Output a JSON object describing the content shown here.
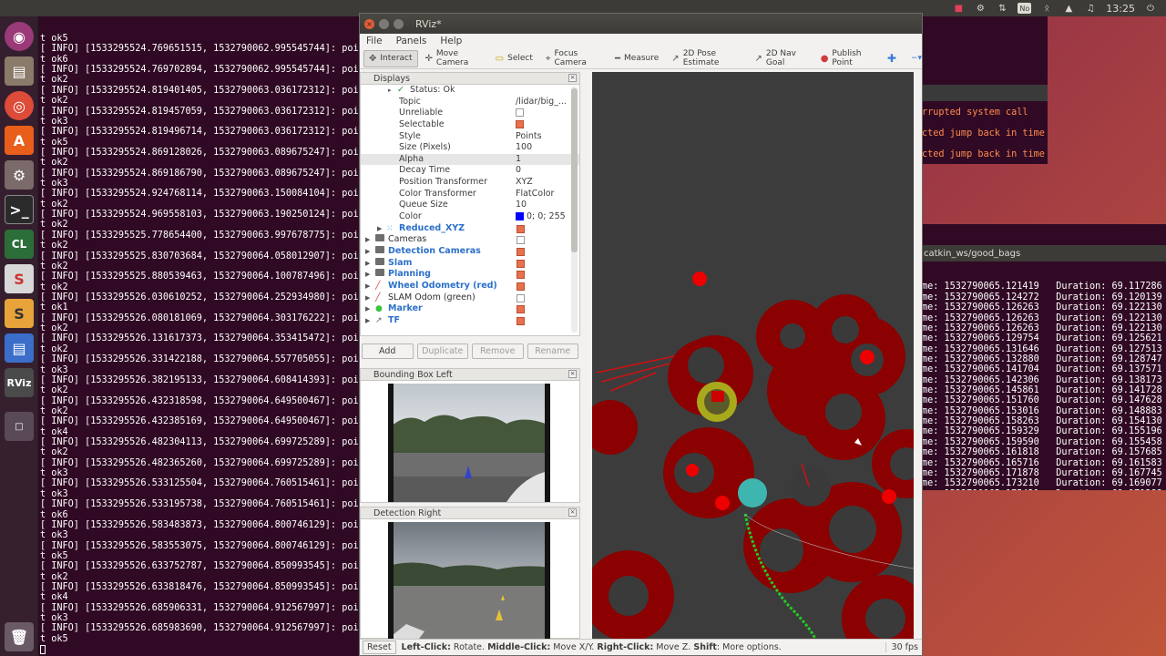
{
  "topbar": {
    "time": "13:25",
    "no_badge": "No"
  },
  "term_left_lines": [
    "t ok5",
    "[ INFO] [1533295524.769651515, 1532790062.995545744]: poin",
    "t ok6",
    "[ INFO] [1533295524.769702894, 1532790062.995545744]: poin",
    "t ok2",
    "[ INFO] [1533295524.819401405, 1532790063.036172312]: poin",
    "t ok2",
    "[ INFO] [1533295524.819457059, 1532790063.036172312]: poin",
    "t ok3",
    "[ INFO] [1533295524.819496714, 1532790063.036172312]: poin",
    "t ok5",
    "[ INFO] [1533295524.869128026, 1532790063.089675247]: poin",
    "t ok2",
    "[ INFO] [1533295524.869186790, 1532790063.089675247]: poin",
    "t ok3",
    "[ INFO] [1533295524.924768114, 1532790063.150084104]: poin",
    "t ok2",
    "[ INFO] [1533295524.969558103, 1532790063.190250124]: poin",
    "t ok2",
    "[ INFO] [1533295525.778654400, 1532790063.997678775]: poin",
    "t ok2",
    "[ INFO] [1533295525.830703684, 1532790064.058012907]: poin",
    "t ok2",
    "[ INFO] [1533295525.880539463, 1532790064.100787496]: poin",
    "t ok2",
    "[ INFO] [1533295526.030610252, 1532790064.252934980]: poin",
    "t ok1",
    "[ INFO] [1533295526.080181069, 1532790064.303176222]: poin",
    "t ok2",
    "[ INFO] [1533295526.131617373, 1532790064.353415472]: poin",
    "t ok2",
    "[ INFO] [1533295526.331422188, 1532790064.557705055]: poin",
    "t ok3",
    "[ INFO] [1533295526.382195133, 1532790064.608414393]: poin",
    "t ok2",
    "[ INFO] [1533295526.432318598, 1532790064.649500467]: poin",
    "t ok2",
    "[ INFO] [1533295526.432385169, 1532790064.649500467]: poin",
    "t ok4",
    "[ INFO] [1533295526.482304113, 1532790064.699725289]: poin",
    "t ok2",
    "[ INFO] [1533295526.482365260, 1532790064.699725289]: poin",
    "t ok3",
    "[ INFO] [1533295526.533125504, 1532790064.760515461]: poin",
    "t ok3",
    "[ INFO] [1533295526.533195738, 1532790064.760515461]: poin",
    "t ok6",
    "[ INFO] [1533295526.583483873, 1532790064.800746129]: poin",
    "t ok3",
    "[ INFO] [1533295526.583553075, 1532790064.800746129]: poin",
    "t ok5",
    "[ INFO] [1533295526.633752787, 1532790064.850993545]: poin",
    "t ok2",
    "[ INFO] [1533295526.633818476, 1532790064.850993545]: poin",
    "t ok4",
    "[ INFO] [1533295526.685906331, 1532790064.912567997]: poin",
    "t ok3",
    "[ INFO] [1533295526.685983690, 1532790064.912567997]: poin",
    "t ok5"
  ],
  "term_right_top_lines": [
    "rrupted system call",
    "",
    "cted jump back in time",
    "cted jump back in time"
  ],
  "term_right_title": "catkin_ws/good_bags",
  "term_right_lines": [
    "me: 1532790065.121419   Duration: 69.117286 /",
    "me: 1532790065.124272   Duration: 69.120139 /",
    "me: 1532790065.126263   Duration: 69.122130 /",
    "me: 1532790065.126263   Duration: 69.122130 /",
    "me: 1532790065.126263   Duration: 69.122130 /",
    "me: 1532790065.129754   Duration: 69.125621 /",
    "me: 1532790065.131646   Duration: 69.127513 /",
    "me: 1532790065.132880   Duration: 69.128747 /",
    "me: 1532790065.141704   Duration: 69.137571 /",
    "me: 1532790065.142306   Duration: 69.138173 /",
    "me: 1532790065.145861   Duration: 69.141728 /",
    "me: 1532790065.151760   Duration: 69.147628 /",
    "me: 1532790065.153016   Duration: 69.148883 /",
    "me: 1532790065.158263   Duration: 69.154130 /",
    "me: 1532790065.159329   Duration: 69.155196 /",
    "me: 1532790065.159590   Duration: 69.155458 /",
    "me: 1532790065.161818   Duration: 69.157685 /",
    "me: 1532790065.165716   Duration: 69.161583 /",
    "me: 1532790065.171878   Duration: 69.167745 /",
    "me: 1532790065.173210   Duration: 69.169077 /",
    "me: 1532790065.175421   Duration: 69.171288 /",
    "me: 1532790065.181978   Duration: 69.177846 /",
    "me: 1532790065.184024   Duration: 69.179891 /"
  ],
  "rviz": {
    "title": "RViz*",
    "menu": [
      "File",
      "Panels",
      "Help"
    ],
    "tools": [
      {
        "label": "Interact",
        "icon": "✥",
        "active": true
      },
      {
        "label": "Move Camera",
        "icon": "✛",
        "active": false
      },
      {
        "label": "Select",
        "icon": "▭",
        "active": false
      },
      {
        "label": "Focus Camera",
        "icon": "⌖",
        "active": false
      },
      {
        "label": "Measure",
        "icon": "━",
        "active": false
      },
      {
        "label": "2D Pose Estimate",
        "icon": "↗",
        "active": false
      },
      {
        "label": "2D Nav Goal",
        "icon": "↗",
        "active": false
      },
      {
        "label": "Publish Point",
        "icon": "●",
        "active": false
      }
    ],
    "displays_title": "Displays",
    "status_ok": "Status: Ok",
    "props": [
      {
        "key": "Topic",
        "value": "/lidar/big_..."
      },
      {
        "key": "Unreliable",
        "check": false
      },
      {
        "key": "Selectable",
        "check": true
      },
      {
        "key": "Style",
        "value": "Points"
      },
      {
        "key": "Size (Pixels)",
        "value": "100"
      },
      {
        "key": "Alpha",
        "value": "1",
        "selected": true
      },
      {
        "key": "Decay Time",
        "value": "0"
      },
      {
        "key": "Position Transformer",
        "value": "XYZ"
      },
      {
        "key": "Color Transformer",
        "value": "FlatColor"
      },
      {
        "key": "Queue Size",
        "value": "10"
      },
      {
        "key": "Color",
        "value": "0; 0; 255",
        "swatch": "#0000ff"
      }
    ],
    "tree": [
      {
        "label": "Reduced_XYZ",
        "blue": true,
        "check": true,
        "icon": "⁙",
        "icolor": "#3aa3d8"
      },
      {
        "label": "Cameras",
        "blue": false,
        "check": false,
        "folder": true
      },
      {
        "label": "Detection Cameras",
        "blue": true,
        "check": true,
        "folder": true
      },
      {
        "label": "Slam",
        "blue": true,
        "check": true,
        "folder": true
      },
      {
        "label": "Planning",
        "blue": true,
        "check": true,
        "folder": true
      },
      {
        "label": "Wheel Odometry (red)",
        "blue": true,
        "check": true,
        "icon": "╱",
        "icolor": "#d23a3a"
      },
      {
        "label": "SLAM Odom (green)",
        "blue": false,
        "check": false,
        "icon": "╱",
        "icolor": "#d23a3a"
      },
      {
        "label": "Marker",
        "blue": true,
        "check": true,
        "icon": "●",
        "icolor": "#3cc43c"
      },
      {
        "label": "TF",
        "blue": true,
        "check": true,
        "icon": "↗",
        "icolor": "#666666"
      }
    ],
    "buttons": [
      {
        "label": "Add",
        "disabled": false
      },
      {
        "label": "Duplicate",
        "disabled": true
      },
      {
        "label": "Remove",
        "disabled": true
      },
      {
        "label": "Rename",
        "disabled": true
      }
    ],
    "cam1_title": "Bounding Box Left",
    "cam2_title": "Detection Right",
    "status": {
      "reset": "Reset",
      "b1": "Left-Click:",
      "t1": " Rotate. ",
      "b2": "Middle-Click:",
      "t2": " Move X/Y. ",
      "b3": "Right-Click:",
      "t3": " Move Z. ",
      "b4": "Shift",
      "t4": ": More options.",
      "fps": "30 fps"
    }
  }
}
